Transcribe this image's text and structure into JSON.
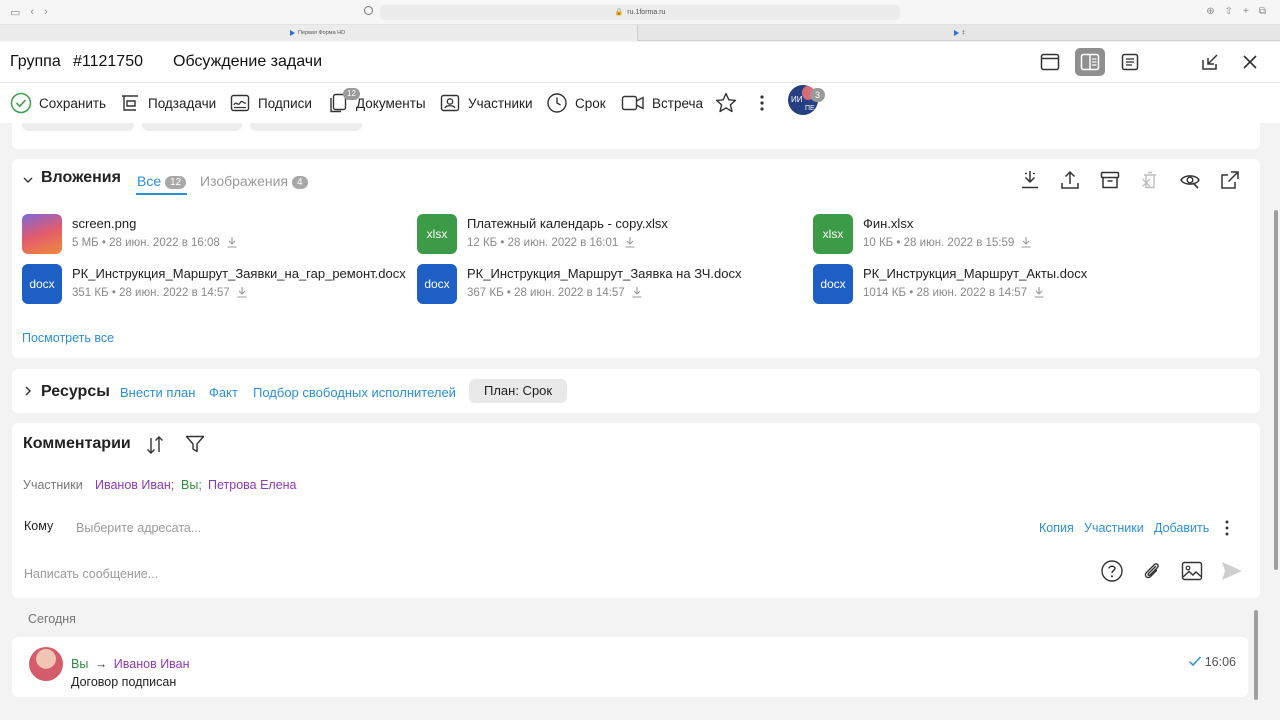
{
  "browser": {
    "url": "ru.1forma.ru",
    "tabs": [
      "Первая Форма HD",
      "‡"
    ]
  },
  "header": {
    "group_label": "Группа",
    "number": "#1121750",
    "title": "Обсуждение задачи"
  },
  "toolbar": {
    "save": "Сохранить",
    "subtasks": "Подзадачи",
    "signatures": "Подписи",
    "documents": "Документы",
    "documents_count": "12",
    "participants": "Участники",
    "deadline": "Срок",
    "meeting": "Встреча",
    "avatar_initials_top": "ИИ",
    "avatar_initials_bottom": "ПЕ",
    "avatar_count": "3"
  },
  "attachments": {
    "title": "Вложения",
    "tabs": [
      {
        "label": "Все",
        "count": "12"
      },
      {
        "label": "Изображения",
        "count": "4"
      }
    ],
    "files": [
      {
        "name": "screen.png",
        "size": "5 МБ",
        "date": "28 июн. 2022 в 16:08",
        "type_label": ""
      },
      {
        "name": "Платежный календарь - copy.xlsx",
        "size": "12 КБ",
        "date": "28 июн. 2022 в 16:01",
        "type_label": "xlsx"
      },
      {
        "name": "Фин.xlsx",
        "size": "10 КБ",
        "date": "28 июн. 2022 в 15:59",
        "type_label": "xlsx"
      },
      {
        "name": "РК_Инструкция_Маршрут_Заявки_на_гар_ремонт.docx",
        "size": "351 КБ",
        "date": "28 июн. 2022 в 14:57",
        "type_label": "docx"
      },
      {
        "name": "РК_Инструкция_Маршрут_Заявка на ЗЧ.docx",
        "size": "367 КБ",
        "date": "28 июн. 2022 в 14:57",
        "type_label": "docx"
      },
      {
        "name": "РК_Инструкция_Маршрут_Акты.docx",
        "size": "1014 КБ",
        "date": "28 июн. 2022 в 14:57",
        "type_label": "docx"
      }
    ],
    "view_all": "Посмотреть все"
  },
  "resources": {
    "title": "Ресурсы",
    "links": [
      "Внести план",
      "Факт",
      "Подбор свободных исполнителей"
    ],
    "plan_pill": "План: Срок"
  },
  "comments": {
    "title": "Комментарии",
    "participants_label": "Участники",
    "participants": [
      "Иванов Иван;",
      "Вы;",
      "Петрова Елена"
    ],
    "to_label": "Кому",
    "to_placeholder": "Выберите адресата...",
    "to_links": [
      "Копия",
      "Участники",
      "Добавить"
    ],
    "message_placeholder": "Написать сообщение..."
  },
  "feed": {
    "day_label": "Сегодня",
    "messages": [
      {
        "from": "Вы",
        "arrow": "→",
        "to": "Иванов Иван",
        "text": "Договор подписан",
        "time": "16:06"
      }
    ]
  },
  "colors": {
    "accent": "#2b8fd8",
    "purple": "#8d3ab5",
    "green": "#2e8b3a",
    "xlsx": "#3c9b47",
    "docx": "#1d5fc5"
  }
}
